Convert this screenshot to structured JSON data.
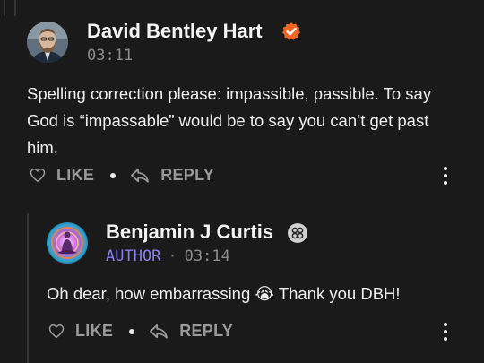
{
  "comment": {
    "author": "David Bentley Hart",
    "time": "03:11",
    "text": "Spelling correction please: impassible, passible. To say God is “impassable” would be to say you can’t get past him.",
    "like_label": "LIKE",
    "reply_label": "REPLY",
    "badge_color": "#f26522"
  },
  "reply": {
    "author": "Benjamin J Curtis",
    "role": "AUTHOR",
    "separator": "·",
    "time": "03:14",
    "text": "Oh dear, how embarrassing 😭 Thank you DBH!",
    "like_label": "LIKE",
    "reply_label": "REPLY"
  },
  "colors": {
    "background": "#1a1a1a",
    "author_accent": "#8a7cf2",
    "verified_badge": "#f26522"
  }
}
